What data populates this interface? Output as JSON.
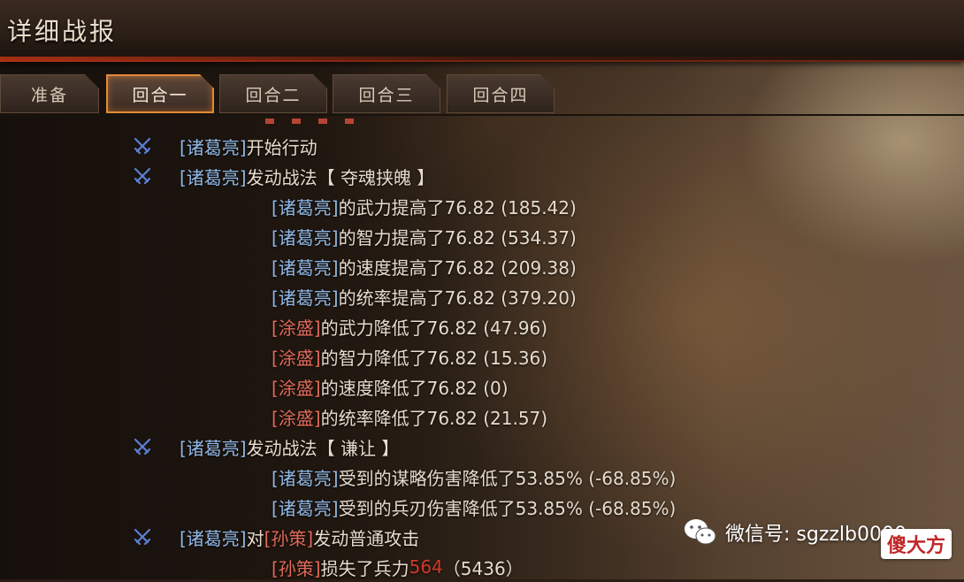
{
  "window": {
    "title": "详细战报"
  },
  "tabs": [
    {
      "label": "准备",
      "active": false
    },
    {
      "label": "回合一",
      "active": true
    },
    {
      "label": "回合二",
      "active": false
    },
    {
      "label": "回合三",
      "active": false
    },
    {
      "label": "回合四",
      "active": false
    }
  ],
  "log": {
    "rows": [
      {
        "parts": [
          [
            "hero",
            "[诸葛亮]"
          ],
          [
            "plain",
            " 开始行动"
          ]
        ]
      },
      {
        "parts": [
          [
            "hero",
            "[诸葛亮]"
          ],
          [
            "plain",
            " 发动战法【 夺魂挟魄 】"
          ]
        ]
      },
      {
        "parts": [
          [
            "hero",
            "[诸葛亮]"
          ],
          [
            "plain",
            "的武力提高了76.82 (185.42)"
          ]
        ]
      },
      {
        "parts": [
          [
            "hero",
            "[诸葛亮]"
          ],
          [
            "plain",
            "的智力提高了76.82 (534.37)"
          ]
        ]
      },
      {
        "parts": [
          [
            "hero",
            "[诸葛亮]"
          ],
          [
            "plain",
            "的速度提高了76.82 (209.38)"
          ]
        ]
      },
      {
        "parts": [
          [
            "hero",
            "[诸葛亮]"
          ],
          [
            "plain",
            "的统率提高了76.82 (379.20)"
          ]
        ]
      },
      {
        "parts": [
          [
            "enemy",
            "[涂盛]"
          ],
          [
            "plain",
            "的武力降低了76.82 (47.96)"
          ]
        ]
      },
      {
        "parts": [
          [
            "enemy",
            "[涂盛]"
          ],
          [
            "plain",
            "的智力降低了76.82 (15.36)"
          ]
        ]
      },
      {
        "parts": [
          [
            "enemy",
            "[涂盛]"
          ],
          [
            "plain",
            "的速度降低了76.82 (0)"
          ]
        ]
      },
      {
        "parts": [
          [
            "enemy",
            "[涂盛]"
          ],
          [
            "plain",
            "的统率降低了76.82 (21.57)"
          ]
        ]
      },
      {
        "parts": [
          [
            "hero",
            "[诸葛亮]"
          ],
          [
            "plain",
            " 发动战法【 谦让 】"
          ]
        ]
      },
      {
        "parts": [
          [
            "hero",
            "[诸葛亮]"
          ],
          [
            "plain",
            "受到的谋略伤害降低了53.85% (-68.85%)"
          ]
        ]
      },
      {
        "parts": [
          [
            "hero",
            "[诸葛亮]"
          ],
          [
            "plain",
            "受到的兵刃伤害降低了53.85% (-68.85%)"
          ]
        ]
      },
      {
        "parts": [
          [
            "hero",
            "[诸葛亮]"
          ],
          [
            "plain",
            " 对"
          ],
          [
            "enemy",
            "[孙策]"
          ],
          [
            "plain",
            "发动普通攻击"
          ]
        ]
      },
      {
        "parts": [
          [
            "enemy",
            "[孙策]"
          ],
          [
            "plain",
            "损失了兵力"
          ],
          [
            "red",
            "564"
          ],
          [
            "plain",
            "（5436）"
          ]
        ]
      }
    ]
  },
  "watermark": {
    "text": "微信号: sgzzlb0000",
    "stamp": "傻大方"
  },
  "colors": {
    "hero": "#8fb8e6",
    "enemy": "#e26a5a",
    "highlight": "#d23a2a",
    "tab_active_border": "#e08a3a"
  },
  "icons": {
    "action_marker": "crossed-swords-icon"
  }
}
